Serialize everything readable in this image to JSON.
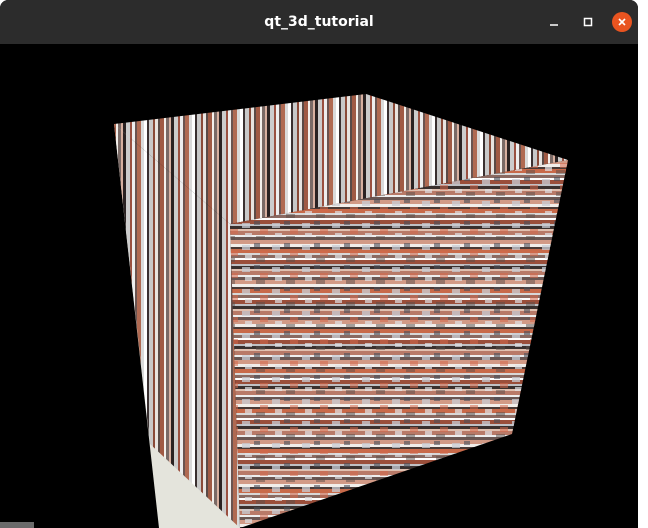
{
  "window": {
    "title": "qt_3d_tutorial",
    "buttons": [
      "minimize-icon",
      "maximize-icon",
      "close-icon"
    ]
  },
  "colors": {
    "titlebar": "#2c2c2c",
    "close_button": "#e95420",
    "viewport": "#000000",
    "cube_side_face": "#e4e4dc"
  }
}
